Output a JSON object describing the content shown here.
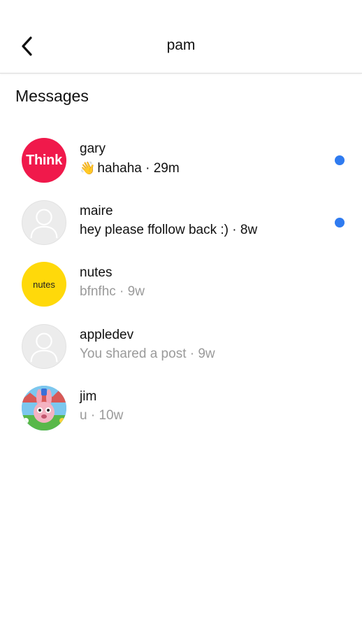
{
  "header": {
    "title": "pam",
    "back_icon": "chevron-left-icon"
  },
  "section": {
    "title": "Messages"
  },
  "accent_color": "#2f7bf0",
  "threads": [
    {
      "name": "gary",
      "preview_emoji": "👋",
      "preview": "hahaha · 29m",
      "unread": true,
      "avatar_text": "Think"
    },
    {
      "name": "maire",
      "preview": "hey please ffollow back :) · 8w",
      "unread": true,
      "avatar_icon": "person-placeholder-icon"
    },
    {
      "name": "nutes",
      "preview": "bfnfhc · 9w",
      "unread": false,
      "avatar_text": "nutes"
    },
    {
      "name": "appledev",
      "preview": "You shared a post · 9w",
      "unread": false,
      "avatar_icon": "person-placeholder-icon"
    },
    {
      "name": "jim",
      "preview": "u · 10w",
      "unread": false,
      "avatar_icon": "cartoon-bunny-avatar"
    }
  ]
}
